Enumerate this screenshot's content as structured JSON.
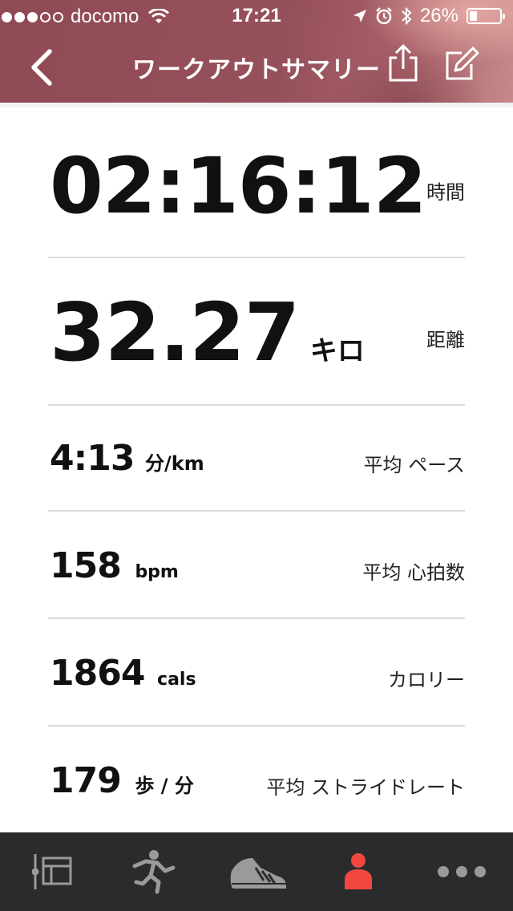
{
  "status_bar": {
    "signal_dots_filled": 3,
    "signal_dots_total": 5,
    "carrier": "docomo",
    "time": "17:21",
    "battery": "26%"
  },
  "nav": {
    "title": "ワークアウトサマリー",
    "back_icon": "chevron-left-icon",
    "share_icon": "share-icon",
    "edit_icon": "edit-icon"
  },
  "stats": [
    {
      "value": "02:16:12",
      "unit": "",
      "label": "時間"
    },
    {
      "value": "32.27",
      "unit": "キロ",
      "label": "距離"
    },
    {
      "value": "4:13",
      "unit": "分/km",
      "label": "平均 ペース"
    },
    {
      "value": "158",
      "unit": "bpm",
      "label": "平均 心拍数"
    },
    {
      "value": "1864",
      "unit": "cals",
      "label": "カロリー"
    },
    {
      "value": "179",
      "unit": "歩 / 分",
      "label": "平均 ストライドレート"
    }
  ],
  "tabbar": {
    "items": [
      {
        "icon": "log-icon",
        "active": false
      },
      {
        "icon": "runner-icon",
        "active": false
      },
      {
        "icon": "shoe-icon",
        "active": false
      },
      {
        "icon": "profile-icon",
        "active": true
      },
      {
        "icon": "more-icon",
        "active": false
      }
    ],
    "active_color": "#f0483e",
    "inactive_color": "#9a9a9a"
  },
  "colors": {
    "header": "#8f4a55",
    "divider": "#dcdcdc",
    "tabbar_bg": "#2b2b2d"
  }
}
